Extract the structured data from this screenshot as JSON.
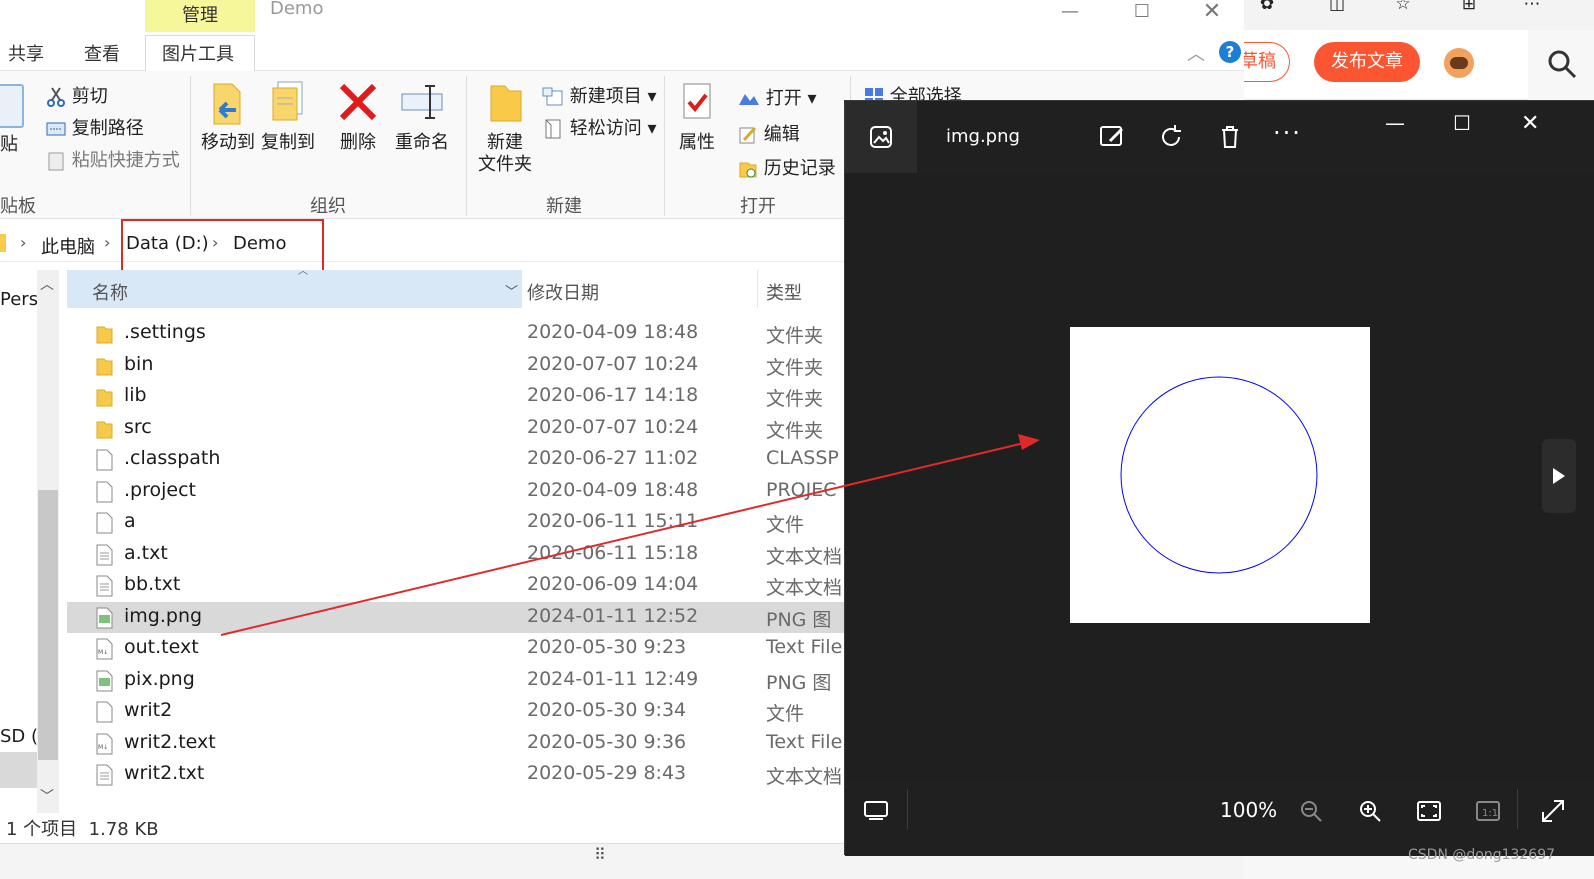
{
  "explorer": {
    "window_title": "Demo",
    "context_tab": "管理",
    "ribbon_tabs": [
      "共享",
      "查看",
      "图片工具"
    ],
    "ribbon": {
      "clipboard": {
        "paste_fragment": "贴",
        "cut": "剪切",
        "copy_path": "复制路径",
        "paste_shortcut": "粘贴快捷方式",
        "group_label": "贴板"
      },
      "organize": {
        "move_to": "移动到",
        "copy_to": "复制到",
        "delete": "删除",
        "rename": "重命名",
        "group_label": "组织"
      },
      "new": {
        "new_folder_line1": "新建",
        "new_folder_line2": "文件夹",
        "new_item": "新建项目",
        "easy_access": "轻松访问",
        "group_label": "新建"
      },
      "open": {
        "properties": "属性",
        "open": "打开",
        "edit": "编辑",
        "history": "历史记录",
        "group_label": "打开"
      },
      "select": {
        "select_all": "全部选择"
      }
    },
    "breadcrumb": [
      "此电脑",
      "Data (D:)",
      "Demo"
    ],
    "nav_fragments": {
      "persona": "Persc",
      "ssd": "SD ("
    },
    "columns": {
      "name": "名称",
      "date": "修改日期",
      "type": "类型"
    },
    "files": [
      {
        "name": ".settings",
        "date": "2020-04-09 18:48",
        "type": "文件夹",
        "icon": "folder"
      },
      {
        "name": "bin",
        "date": "2020-07-07 10:24",
        "type": "文件夹",
        "icon": "folder"
      },
      {
        "name": "lib",
        "date": "2020-06-17 14:18",
        "type": "文件夹",
        "icon": "folder"
      },
      {
        "name": "src",
        "date": "2020-07-07 10:24",
        "type": "文件夹",
        "icon": "folder"
      },
      {
        "name": ".classpath",
        "date": "2020-06-27 11:02",
        "type": "CLASSP",
        "icon": "file"
      },
      {
        "name": ".project",
        "date": "2020-04-09 18:48",
        "type": "PROJEC",
        "icon": "file"
      },
      {
        "name": "a",
        "date": "2020-06-11 15:11",
        "type": "文件",
        "icon": "file"
      },
      {
        "name": "a.txt",
        "date": "2020-06-11 15:18",
        "type": "文本文档",
        "icon": "text"
      },
      {
        "name": "bb.txt",
        "date": "2020-06-09 14:04",
        "type": "文本文档",
        "icon": "text"
      },
      {
        "name": "img.png",
        "date": "2024-01-11 12:52",
        "type": "PNG 图",
        "icon": "image",
        "selected": true
      },
      {
        "name": "out.text",
        "date": "2020-05-30 9:23",
        "type": "Text File",
        "icon": "md"
      },
      {
        "name": "pix.png",
        "date": "2024-01-11 12:49",
        "type": "PNG 图",
        "icon": "image"
      },
      {
        "name": "writ2",
        "date": "2020-05-30 9:34",
        "type": "文件",
        "icon": "file"
      },
      {
        "name": "writ2.text",
        "date": "2020-05-30 9:36",
        "type": "Text File",
        "icon": "md"
      },
      {
        "name": "writ2.txt",
        "date": "2020-05-29 8:43",
        "type": "文本文档",
        "icon": "text"
      }
    ],
    "status": {
      "count": "1 个项目",
      "size": "1.78 KB"
    }
  },
  "viewer": {
    "file_name": "img.png",
    "zoom": "100%"
  },
  "browser": {
    "draft_label": "草稿",
    "publish_label": "发布文章"
  },
  "watermark": "CSDN @dong132697",
  "colors": {
    "accent_red": "#e02a2a",
    "publish_orange": "#fc5531",
    "circle_blue": "#0000ff",
    "context_tab_yellow": "#f6f69b",
    "selection_gray": "#d9d9d9"
  }
}
